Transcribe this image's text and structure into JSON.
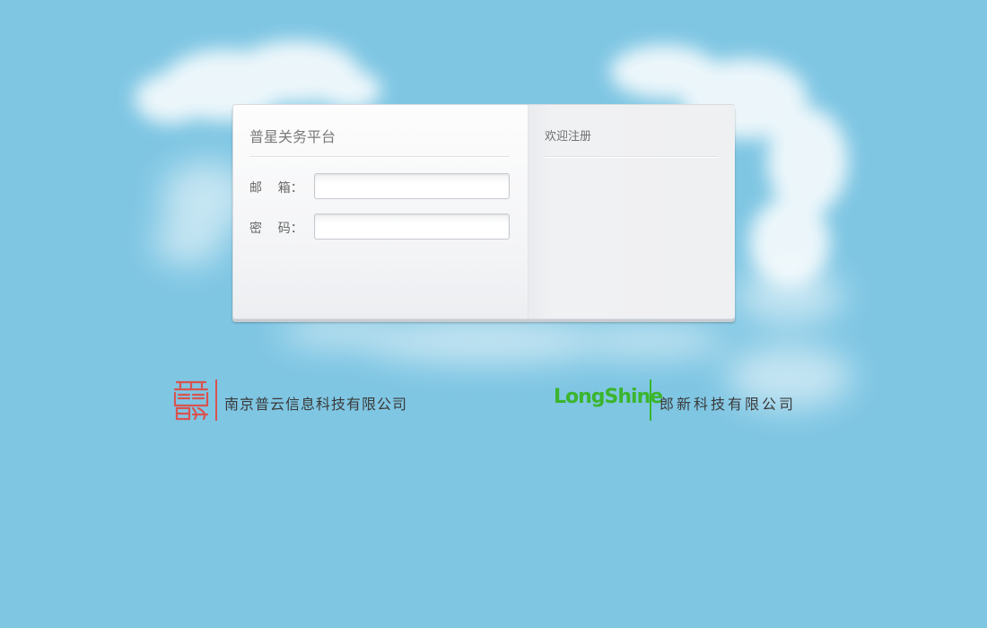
{
  "login": {
    "title": "普星关务平台",
    "email_label": "邮    箱：",
    "email_value": "",
    "password_label": "密    码：",
    "password_value": ""
  },
  "register": {
    "title": "欢迎注册"
  },
  "footer": {
    "left_company": "南京普云信息科技有限公司",
    "right_brand": "LongShine",
    "right_company": "郎新科技有限公司"
  },
  "colors": {
    "sky": "#7fc6e3",
    "seal_red": "#d9534f",
    "brand_green": "#3bb52e"
  },
  "icons": {
    "left_logo": "seal-logo-icon",
    "right_logo": "longshine-logo"
  }
}
